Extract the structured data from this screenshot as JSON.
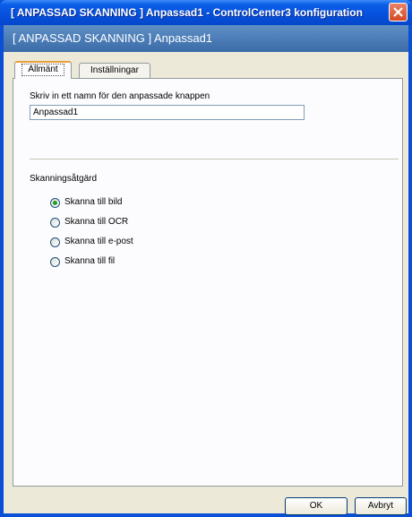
{
  "window": {
    "title": "[ ANPASSAD SKANNING ]  Anpassad1 - ControlCenter3 konfiguration",
    "close_icon": "close-icon"
  },
  "header": {
    "text": "[ ANPASSAD SKANNING ]  Anpassad1"
  },
  "tabs": [
    {
      "label": "Allmänt",
      "active": true
    },
    {
      "label": "Inställningar",
      "active": false
    }
  ],
  "form": {
    "name_prompt": "Skriv in ett namn för den anpassade knappen",
    "name_value": "Anpassad1",
    "action_label": "Skanningsåtgärd",
    "options": [
      {
        "label": "Skanna till bild",
        "selected": true
      },
      {
        "label": "Skanna till OCR",
        "selected": false
      },
      {
        "label": "Skanna till e-post",
        "selected": false
      },
      {
        "label": "Skanna till fil",
        "selected": false
      }
    ]
  },
  "buttons": {
    "ok": "OK",
    "cancel": "Avbryt"
  },
  "colors": {
    "titlebar": "#0550dc",
    "header_band": "#4a7bb7",
    "dialog_bg": "#ece9d8",
    "close_button": "#d44a24"
  }
}
